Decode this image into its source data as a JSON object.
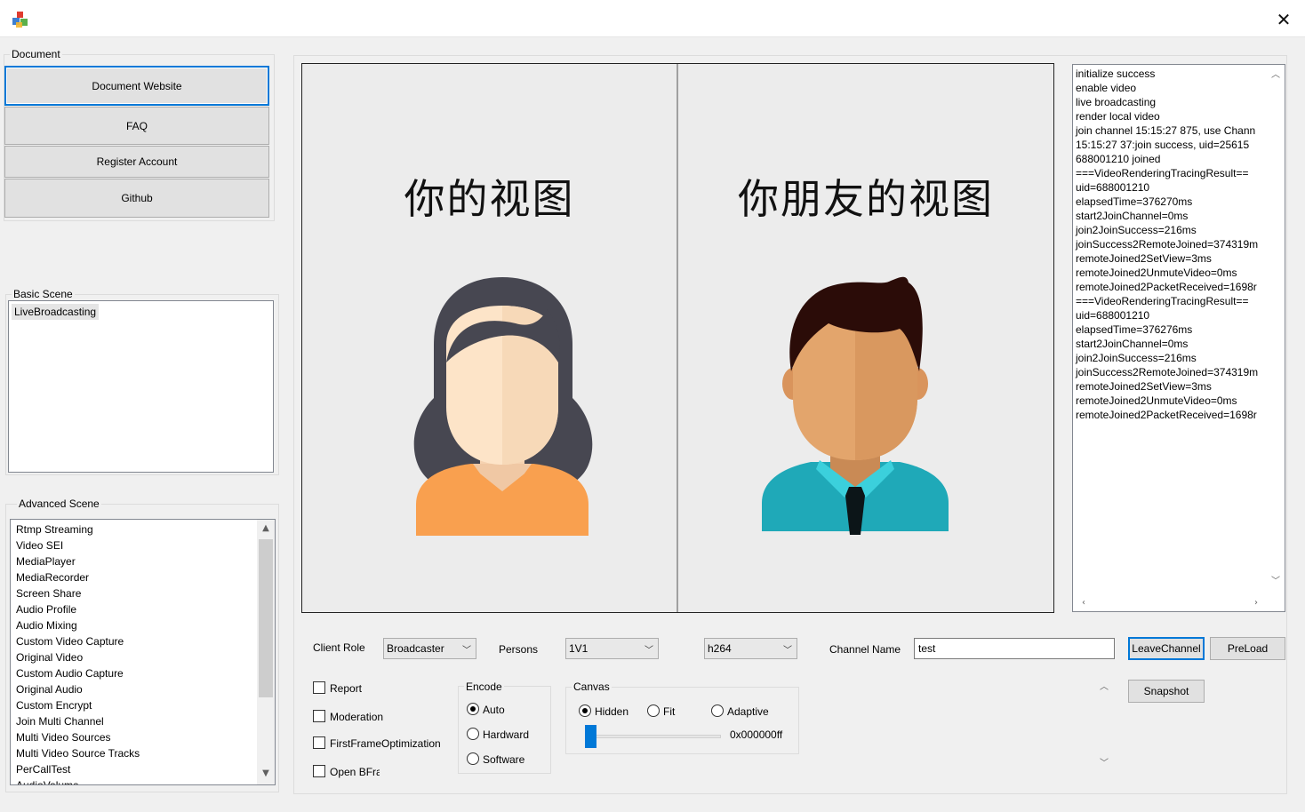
{
  "document": {
    "group_title": "Document",
    "buttons": [
      "Document Website",
      "FAQ",
      "Register Account",
      "Github"
    ]
  },
  "basic_scene": {
    "group_title": "Basic Scene",
    "items": [
      "LiveBroadcasting"
    ]
  },
  "advanced_scene": {
    "group_title": "Advanced Scene",
    "items": [
      "Rtmp Streaming",
      "Video SEI",
      "MediaPlayer",
      "MediaRecorder",
      "Screen Share",
      "Audio Profile",
      "Audio Mixing",
      "Custom Video Capture",
      "Original Video",
      "Custom Audio Capture",
      "Original Audio",
      "Custom Encrypt",
      "Join Multi Channel",
      "Multi Video Sources",
      "Multi Video Source Tracks",
      "PerCallTest",
      "AudioVolume"
    ]
  },
  "video": {
    "local_label": "你的视图",
    "remote_label": "你朋友的视图"
  },
  "log": {
    "lines": [
      "initialize success",
      "enable video",
      "live broadcasting",
      "render local video",
      "join channel 15:15:27 875, use Chann",
      "15:15:27 37:join success, uid=25615",
      "688001210 joined",
      "===VideoRenderingTracingResult==",
      "uid=688001210",
      "elapsedTime=376270ms",
      "start2JoinChannel=0ms",
      "join2JoinSuccess=216ms",
      "joinSuccess2RemoteJoined=374319m",
      "remoteJoined2SetView=3ms",
      "remoteJoined2UnmuteVideo=0ms",
      "remoteJoined2PacketReceived=1698r",
      "===VideoRenderingTracingResult==",
      "uid=688001210",
      "elapsedTime=376276ms",
      "start2JoinChannel=0ms",
      "join2JoinSuccess=216ms",
      "joinSuccess2RemoteJoined=374319m",
      "remoteJoined2SetView=3ms",
      "remoteJoined2UnmuteVideo=0ms",
      "remoteJoined2PacketReceived=1698r"
    ]
  },
  "controls": {
    "client_role_label": "Client Role",
    "client_role_value": "Broadcaster",
    "persons_label": "Persons",
    "persons_value": "1V1",
    "codec_value": "h264",
    "channel_name_label": "Channel Name",
    "channel_name_value": "test",
    "leave_channel": "LeaveChannel",
    "preload": "PreLoad",
    "snapshot": "Snapshot",
    "checkboxes": [
      "Report",
      "Moderation",
      "FirstFrameOptimization",
      "Open BFra"
    ],
    "encode": {
      "title": "Encode",
      "options": [
        "Auto",
        "Hardward",
        "Software"
      ],
      "selected": "Auto"
    },
    "canvas": {
      "title": "Canvas",
      "options": [
        "Hidden",
        "Fit",
        "Adaptive"
      ],
      "selected": "Hidden",
      "color_value": "0x000000ff"
    }
  },
  "colors": {
    "focus_blue": "#0078d7",
    "woman_hair": "#474751",
    "woman_skin": "#fde4c8",
    "woman_shirt": "#f9a04f",
    "man_hair": "#2b0c08",
    "man_skin": "#e3a56c",
    "man_shirt": "#1fa9b8"
  }
}
